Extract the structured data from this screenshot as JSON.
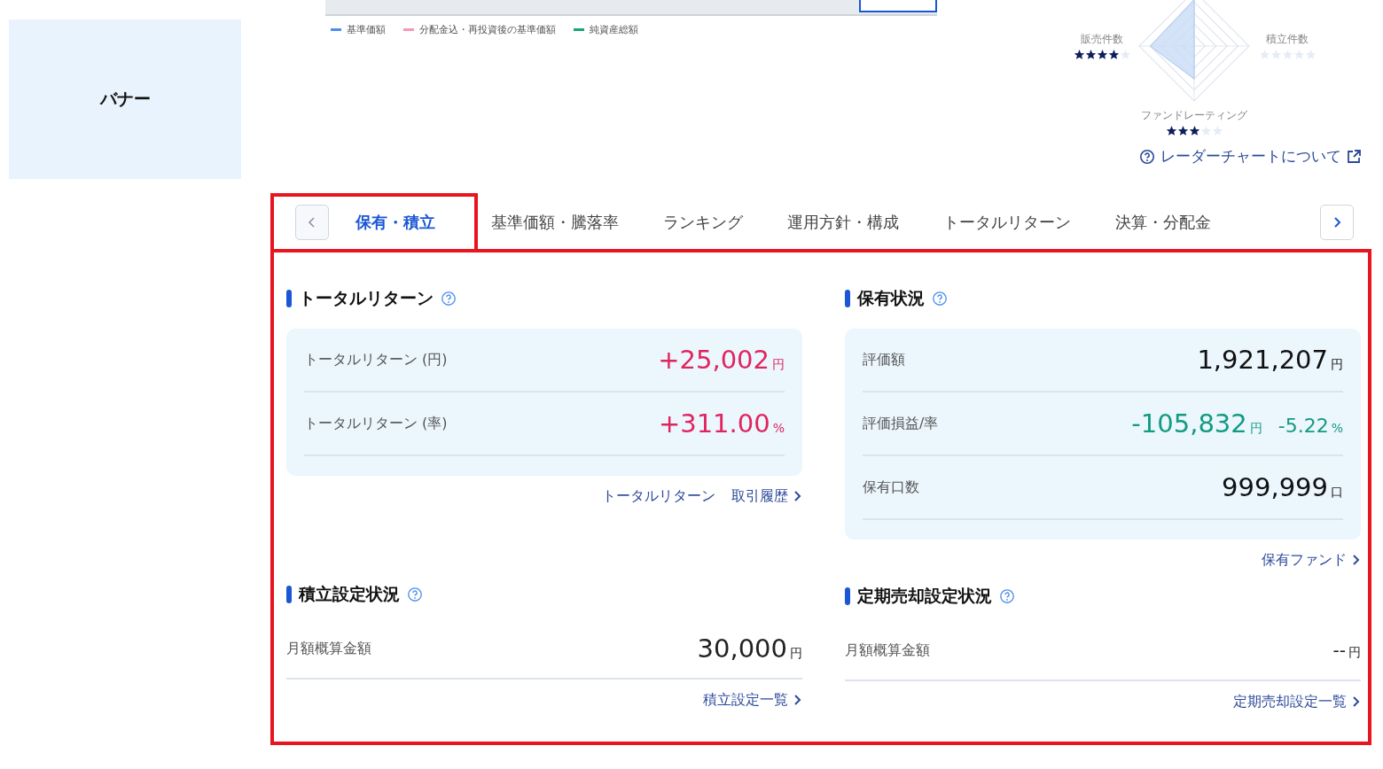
{
  "banner": {
    "label": "バナー"
  },
  "chart_legend": [
    {
      "label": "基準価額",
      "color": "#4a8ef0"
    },
    {
      "label": "分配金込・再投資後の基準価額",
      "color": "#f29ab4"
    },
    {
      "label": "純資産総額",
      "color": "#1aa37a"
    }
  ],
  "radar": {
    "axes": [
      {
        "label": "販売件数",
        "kind": "left",
        "stars": 4
      },
      {
        "label": "積立件数",
        "kind": "right",
        "stars": 0
      },
      {
        "label": "ファンドレーティング",
        "kind": "bottom",
        "stars": 3
      }
    ],
    "link": "レーダーチャートについて"
  },
  "tabs": [
    {
      "label": "保有・積立",
      "selected": true
    },
    {
      "label": "基準価額・騰落率",
      "selected": false
    },
    {
      "label": "ランキング",
      "selected": false
    },
    {
      "label": "運用方針・構成",
      "selected": false
    },
    {
      "label": "トータルリターン",
      "selected": false
    },
    {
      "label": "決算・分配金",
      "selected": false
    }
  ],
  "total_return": {
    "title": "トータルリターン",
    "rows": [
      {
        "label": "トータルリターン (円)",
        "value": "+25,002",
        "unit": "円",
        "color": "#e0245e"
      },
      {
        "label": "トータルリターン (率)",
        "value": "+311.00",
        "unit": "%",
        "color": "#e0245e"
      }
    ],
    "links": [
      "トータルリターン",
      "取引履歴"
    ]
  },
  "holdings": {
    "title": "保有状況",
    "rows": [
      {
        "label": "評価額",
        "value": "1,921,207",
        "unit": "円",
        "color": "#111111"
      },
      {
        "label": "評価損益/率",
        "value": "-105,832",
        "unit": "円",
        "value2": "-5.22",
        "unit2": "%",
        "color": "#129a82"
      },
      {
        "label": "保有口数",
        "value": "999,999",
        "unit": "口",
        "color": "#111111"
      }
    ],
    "link": "保有ファンド"
  },
  "accumulation": {
    "title": "積立設定状況",
    "label": "月額概算金額",
    "value": "30,000",
    "unit": "円",
    "link": "積立設定一覧"
  },
  "periodic_sale": {
    "title": "定期売却設定状況",
    "label": "月額概算金額",
    "value": "--",
    "unit": "円",
    "link": "定期売却設定一覧"
  }
}
